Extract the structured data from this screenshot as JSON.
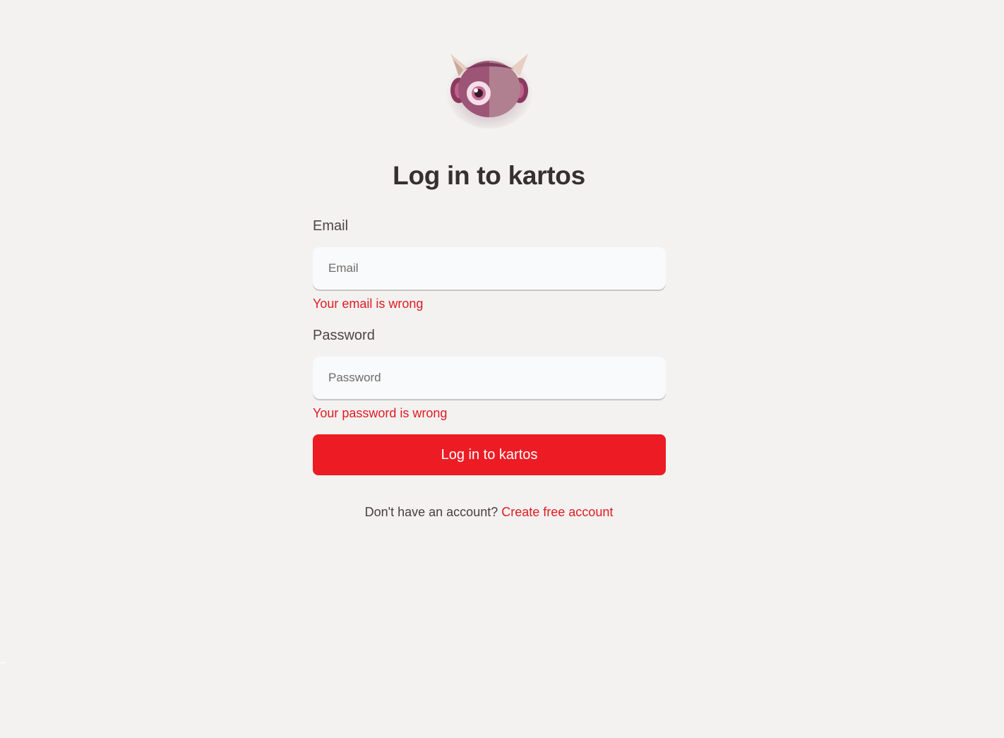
{
  "app": {
    "logo_icon": "monster-mascot-icon",
    "title": "Log in to kartos"
  },
  "form": {
    "email": {
      "label": "Email",
      "placeholder": "Email",
      "value": "",
      "error": "Your email is wrong"
    },
    "password": {
      "label": "Password",
      "placeholder": "Password",
      "value": "",
      "error": "Your password is wrong"
    },
    "submit_label": "Log in to kartos"
  },
  "signup": {
    "prompt": "Don't have an account?",
    "link_label": "Create free account"
  },
  "colors": {
    "background": "#f3f2f0",
    "accent": "#ed1c24",
    "error": "#e01a22",
    "text_dark": "#35312e",
    "input_bg": "#f9fafb"
  }
}
